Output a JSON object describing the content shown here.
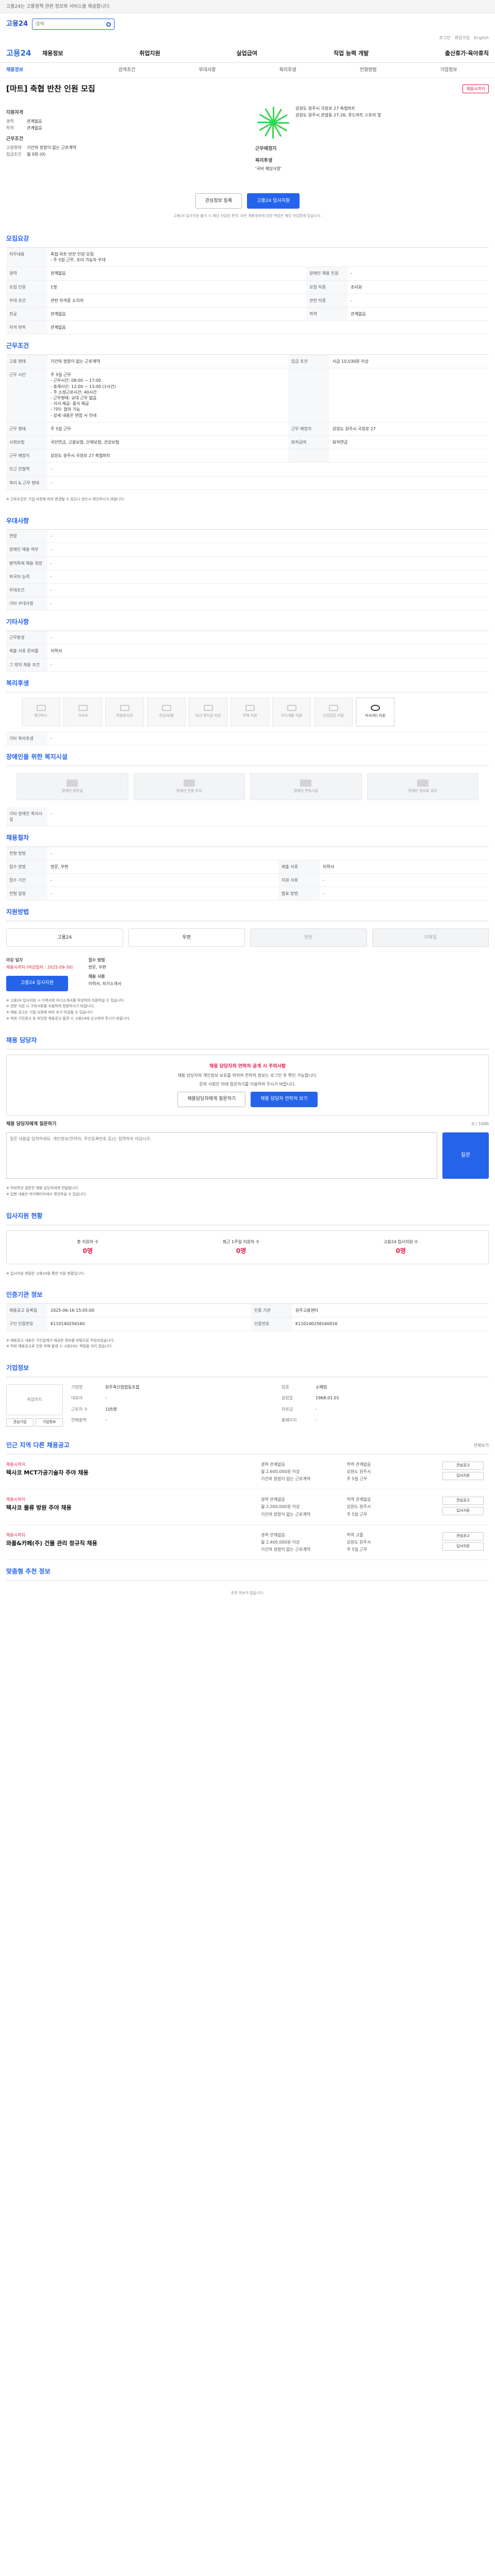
{
  "header": {
    "notice": "고용24는 고용정책 관련 정보와 서비스를 제공합니다.",
    "brand": "고용24",
    "search_placeholder": "검색",
    "util": [
      "로그인",
      "회원가입",
      "English"
    ],
    "logo": "고용24",
    "menu": [
      "채용정보",
      "취업지원",
      "실업급여",
      "직업 능력 개발",
      "출산휴가·육아휴직"
    ],
    "subnav": [
      "채용정보",
      "검색조건",
      "우대사항",
      "복리후생",
      "전형방법",
      "기업정보"
    ]
  },
  "job": {
    "title": "[마트] 축협 반찬 인원 모집",
    "badge": "채용시까지",
    "summary_label": "지원자격",
    "exp_k": "경력",
    "exp_v": "관계없음",
    "edu_k": "학력",
    "edu_v": "관계없음",
    "cond_label": "근무조건",
    "emp_k": "고용형태",
    "emp_v": "기간의 정함이 없는 근로계약",
    "wage_k": "임금조건",
    "wage_v": "월 0원 (0)",
    "place_label": "근무예정지",
    "place_v": "강원도 원주시 국원로 27 축협마트",
    "map_caption": "강원도 원주시 관설동 27-26, 푸드마트 스토리 앞",
    "welfare_label": "복리후생",
    "welfare_v": "'국비 해당사항'",
    "btn_scrap": "관심정보 등록",
    "btn_apply": "고용24 입사지원",
    "note": "고용24 입사지원 불가 시 해당 사업장 문의, 모든 채용정보에 대한 책임은 해당 사업장에 있습니다."
  },
  "requirements": {
    "title": "모집요강",
    "rows": [
      {
        "k": "직무내용",
        "v": "축협 마트 반찬 인원 모집\n- 주 5일 근무, 조리 가능자 우대"
      },
      {
        "k": "경력",
        "v": "관계없음",
        "k2": "장애인 채용 인원",
        "v2": "-"
      },
      {
        "k": "모집 인원",
        "v": "1명",
        "k2": "모집 직종",
        "v2": "조리원"
      },
      {
        "k": "우대 조건",
        "v": "관련 자격증 소지자",
        "k2": "관련 직종",
        "v2": "-"
      },
      {
        "k": "전공",
        "v": "관계없음",
        "k2": "학력",
        "v2": "관계없음"
      },
      {
        "k": "자격 면허",
        "v": "관계없음"
      }
    ]
  },
  "conditions": {
    "title": "근무조건",
    "rows": [
      {
        "k": "고용 형태",
        "v": "기간의 정함이 없는 근로계약",
        "k2": "임금 조건",
        "v2": "시급 10,030원 이상"
      },
      {
        "k": "근무 시간",
        "v": "주 5일 근무\n- 근무시간: 08:00 ~ 17:00\n- 휴게시간: 12:00 ~ 13:00 (1시간)\n- 주 소정근로시간: 40시간\n- 근무형태: 교대 근무 없음\n- 식사 제공: 중식 제공\n- 기타: 협의 가능\n- 상세 내용은 면접 시 안내",
        "k2": "",
        "v2": ""
      },
      {
        "k": "근무 형태",
        "v": "주 5일 근무",
        "k2": "근무 예정지",
        "v2": "강원도 원주시 국원로 27"
      },
      {
        "k": "사회보험",
        "v": "국민연금, 고용보험, 산재보험, 건강보험",
        "k2": "퇴직급여",
        "v2": "퇴직연금"
      },
      {
        "k": "근무 예정지",
        "v": "강원도 원주시 국원로 27 축협마트",
        "k2": "",
        "v2": ""
      },
      {
        "k": "인근 전철역",
        "v": "-"
      },
      {
        "k": "복리 & 근무 형태",
        "v": "-"
      }
    ],
    "footnote": "※ 근로조건은 기업 사정에 따라 변경될 수 있으니 반드시 확인하시기 바랍니다."
  },
  "preference": {
    "title": "우대사항",
    "rows": [
      {
        "k": "연령",
        "v": "-"
      },
      {
        "k": "장애인 채용 여부",
        "v": "-"
      },
      {
        "k": "병역특례 채용 희망",
        "v": "-"
      },
      {
        "k": "외국어 능력",
        "v": "-"
      },
      {
        "k": "우대조건",
        "v": "-"
      },
      {
        "k": "기타 우대사항",
        "v": "-"
      }
    ]
  },
  "etc": {
    "title": "기타사항",
    "rows": [
      {
        "k": "근무환경",
        "v": "-"
      },
      {
        "k": "제출 서류 준비물",
        "v": "이력서"
      }
    ],
    "extra": "그 밖의 채용 조건",
    "extra_v": "-"
  },
  "benefits": {
    "title": "복리후생",
    "items": [
      {
        "name": "통근버스",
        "on": false
      },
      {
        "name": "기숙사",
        "on": false
      },
      {
        "name": "차량유지비",
        "on": false
      },
      {
        "name": "연금/보험",
        "on": false
      },
      {
        "name": "자녀 학자금 지원",
        "on": false
      },
      {
        "name": "주택 지원",
        "on": false
      },
      {
        "name": "자기개발 지원",
        "on": false
      },
      {
        "name": "건강검진 지원",
        "on": false
      },
      {
        "name": "식사(비) 지원",
        "on": true
      }
    ],
    "rows": [
      {
        "k": "기타 복리후생",
        "v": "-"
      }
    ]
  },
  "disability": {
    "title": "장애인을 위한 복지시설",
    "cards": [
      "장애인 화장실",
      "장애인 전용 주차",
      "장애인 편의시설",
      "장애인 경사로 설치"
    ],
    "row_k": "기타 장애인 복지시설",
    "row_v": "-"
  },
  "selection": {
    "title": "채용절차",
    "rows": [
      {
        "k": "전형 방법",
        "v": "-"
      },
      {
        "k": "접수 방법",
        "v": "방문, 우편",
        "k2": "제출 서류",
        "v2": "이력서"
      },
      {
        "k": "접수 기간",
        "v": "-",
        "k2": "지원 서류",
        "v2": "-"
      },
      {
        "k": "전형 일정",
        "v": "-",
        "k2": "발표 방법",
        "v2": "-"
      }
    ]
  },
  "howto": {
    "title": "지원방법",
    "modes": [
      "고용24",
      "우편",
      "방문",
      "이메일"
    ],
    "col1_k": "마감 일자",
    "col1_v": "채용시까지 (마감일자 : 2025-09-30)",
    "col2_k": "접수 방법",
    "col2_v": "방문, 우편",
    "col3_k": "채용 서류",
    "col3_v": "이력서, 자기소개서",
    "apply_btn": "고용24 입사지원",
    "bullets": [
      "※ 고용24 입사지원 시 이력서와 자기소개서를 작성하여 지원하실 수 있습니다.",
      "※ 방문 지원 시 구비서류를 지참하여 방문하시기 바랍니다.",
      "※ 채용 공고는 기업 사정에 따라 조기 마감될 수 있습니다.",
      "※ 허위 구인광고 등 부당한 채용공고 발견 시 고용24에 신고하여 주시기 바랍니다."
    ]
  },
  "inquiry": {
    "title": "채용 담당자",
    "warning": "채용 담당자의 연락처 공개 시 주의사항",
    "p1": "채용 담당자의 개인정보 보호를 위하여 연락처 정보는 로그인 후 확인 가능합니다.",
    "p2": "문의 사항은 아래 질문하기를 이용하여 주시기 바랍니다.",
    "btn1": "채용담당자에게 질문하기",
    "btn2": "채용 담당자 연락처 보기",
    "q_label": "채용 담당자에게 질문하기",
    "q_counter": "0 / 1000",
    "q_placeholder": "질문 내용을 입력하세요. 개인정보(연락처, 주민등록번호 등)는 입력하지 마십시오.",
    "q_btn": "질문",
    "notes": [
      "※ 작성하신 질문은 채용 담당자에게 전달됩니다.",
      "※ 답변 내용은 마이페이지에서 확인하실 수 있습니다."
    ]
  },
  "status": {
    "title": "입사지원 현황",
    "items": [
      {
        "k": "총 지원자 수",
        "v": "0명"
      },
      {
        "k": "최근 1주일 지원자 수",
        "v": "0명"
      },
      {
        "k": "고용24 입사지원 수",
        "v": "0명"
      }
    ],
    "note": "※ 입사지원 현황은 고용24를 통한 지원 현황입니다."
  },
  "posting": {
    "title": "인증기관 정보",
    "rows": [
      {
        "k": "채용공고 등록일",
        "v": "2025-06-16 15:05:00",
        "k2": "인증 기관",
        "v2": "원주고용센터"
      },
      {
        "k": "구인 인증번호",
        "v": "K110140256160",
        "k2": "인증번호",
        "v2": "K110140256160016"
      }
    ],
    "notes": [
      "※ 채용공고 내용은 구인업체가 제공한 정보를 바탕으로 작성되었습니다.",
      "※ 허위 채용공고로 인한 피해 발생 시 고용24는 책임을 지지 않습니다."
    ]
  },
  "company": {
    "title": "기업정보",
    "logo": "축협마트",
    "btn_follow": "관심기업",
    "btn_info": "기업정보",
    "rows": [
      [
        "기업명",
        "원주축산업협동조합",
        "업종",
        "소매업"
      ],
      [
        "대표자",
        "-",
        "설립일",
        "1968.01.01"
      ],
      [
        "근로자 수",
        "105명",
        "자본금",
        "-"
      ],
      [
        "연매출액",
        "-",
        "홈페이지",
        "-"
      ]
    ]
  },
  "related": {
    "title": "인근 지역 다른 채용공고",
    "more": "전체보기",
    "items": [
      {
        "tag": "채용시까지",
        "title": "텍사코 MCT가공기술자 주야 채용",
        "a": "경력 관계없음",
        "b": "학력 관계없음",
        "c": "월 2,600,000원 이상",
        "d": "강원도 원주시",
        "e": "기간의 정함이 없는 근로계약",
        "f": "주 5일 근무"
      },
      {
        "tag": "채용시까지",
        "title": "텍사코 물류 방원 주야 채용",
        "a": "경력 관계없음",
        "b": "학력 관계없음",
        "c": "월 2,300,000원 이상",
        "d": "강원도 원주시",
        "e": "기간의 정함이 없는 근로계약",
        "f": "주 5일 근무"
      },
      {
        "tag": "채용시까지",
        "title": "와플&카페(주) 건물 관리 정규직 채용",
        "a": "경력 관계없음",
        "b": "학력 고졸",
        "c": "월 2,400,000원 이상",
        "d": "강원도 원주시",
        "e": "기간의 정함이 없는 근로계약",
        "f": "주 5일 근무"
      }
    ],
    "btns": [
      "관심공고",
      "입사지원"
    ]
  },
  "ads": {
    "title": "맞춤형 추천 정보",
    "empty": "추천 정보가 없습니다."
  }
}
